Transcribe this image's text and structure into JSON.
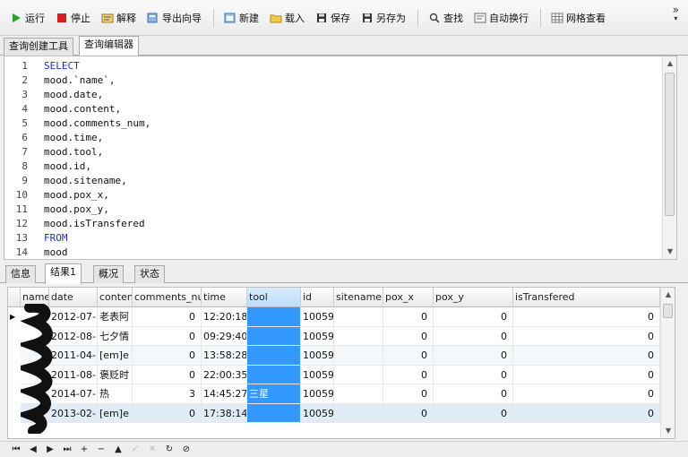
{
  "toolbar": {
    "run": "运行",
    "stop": "停止",
    "explain": "解释",
    "export_wizard": "导出向导",
    "new": "新建",
    "load": "载入",
    "save": "保存",
    "save_as": "另存为",
    "find": "查找",
    "word_wrap": "自动换行",
    "grid_view": "网格查看",
    "overflow": "»"
  },
  "top_tabs": [
    "查询创建工具",
    "查询编辑器"
  ],
  "editor": {
    "lines": [
      {
        "n": "1",
        "text": "SELECT",
        "kw": true
      },
      {
        "n": "2",
        "text": "mood.`name`,",
        "kw": false
      },
      {
        "n": "3",
        "text": "mood.date,",
        "kw": false
      },
      {
        "n": "4",
        "text": "mood.content,",
        "kw": false
      },
      {
        "n": "5",
        "text": "mood.comments_num,",
        "kw": false
      },
      {
        "n": "6",
        "text": "mood.time,",
        "kw": false
      },
      {
        "n": "7",
        "text": "mood.tool,",
        "kw": false
      },
      {
        "n": "8",
        "text": "mood.id,",
        "kw": false
      },
      {
        "n": "9",
        "text": "mood.sitename,",
        "kw": false
      },
      {
        "n": "10",
        "text": "mood.pox_x,",
        "kw": false
      },
      {
        "n": "11",
        "text": "mood.pox_y,",
        "kw": false
      },
      {
        "n": "12",
        "text": "mood.isTransfered",
        "kw": false
      },
      {
        "n": "13",
        "text": "FROM",
        "kw": true
      },
      {
        "n": "14",
        "text": "mood",
        "kw": false
      }
    ]
  },
  "bottom_tabs": [
    "信息",
    "结果1",
    "概况",
    "状态"
  ],
  "grid": {
    "columns": [
      "name",
      "date",
      "content",
      "comments_num",
      "time",
      "tool",
      "id",
      "sitename",
      "pox_x",
      "pox_y",
      "isTransfered"
    ],
    "rows": [
      [
        "",
        "2012-07-",
        "老表阿",
        "0",
        "12:20:18",
        "",
        "10059",
        "",
        "0",
        "0",
        "0"
      ],
      [
        "",
        "2012-08-",
        "七夕情",
        "0",
        "09:29:40",
        "",
        "10059",
        "",
        "0",
        "0",
        "0"
      ],
      [
        "",
        "2011-04-",
        "[em]e",
        "0",
        "13:58:28",
        "",
        "10059",
        "",
        "0",
        "0",
        "0"
      ],
      [
        "",
        "2011-08-",
        "褒贬时",
        "0",
        "22:00:35",
        "",
        "10059",
        "",
        "0",
        "0",
        "0"
      ],
      [
        "",
        "2014-07-",
        "热",
        "3",
        "14:45:27",
        "三星",
        "10059",
        "",
        "0",
        "0",
        "0"
      ],
      [
        "",
        "2013-02-",
        "[em]e",
        "0",
        "17:38:14",
        "",
        "10059",
        "",
        "0",
        "0",
        "0"
      ]
    ]
  },
  "navigator": [
    "first",
    "prev",
    "next",
    "last",
    "insert",
    "delete",
    "up",
    "apply",
    "cancel",
    "refresh",
    "stop"
  ]
}
